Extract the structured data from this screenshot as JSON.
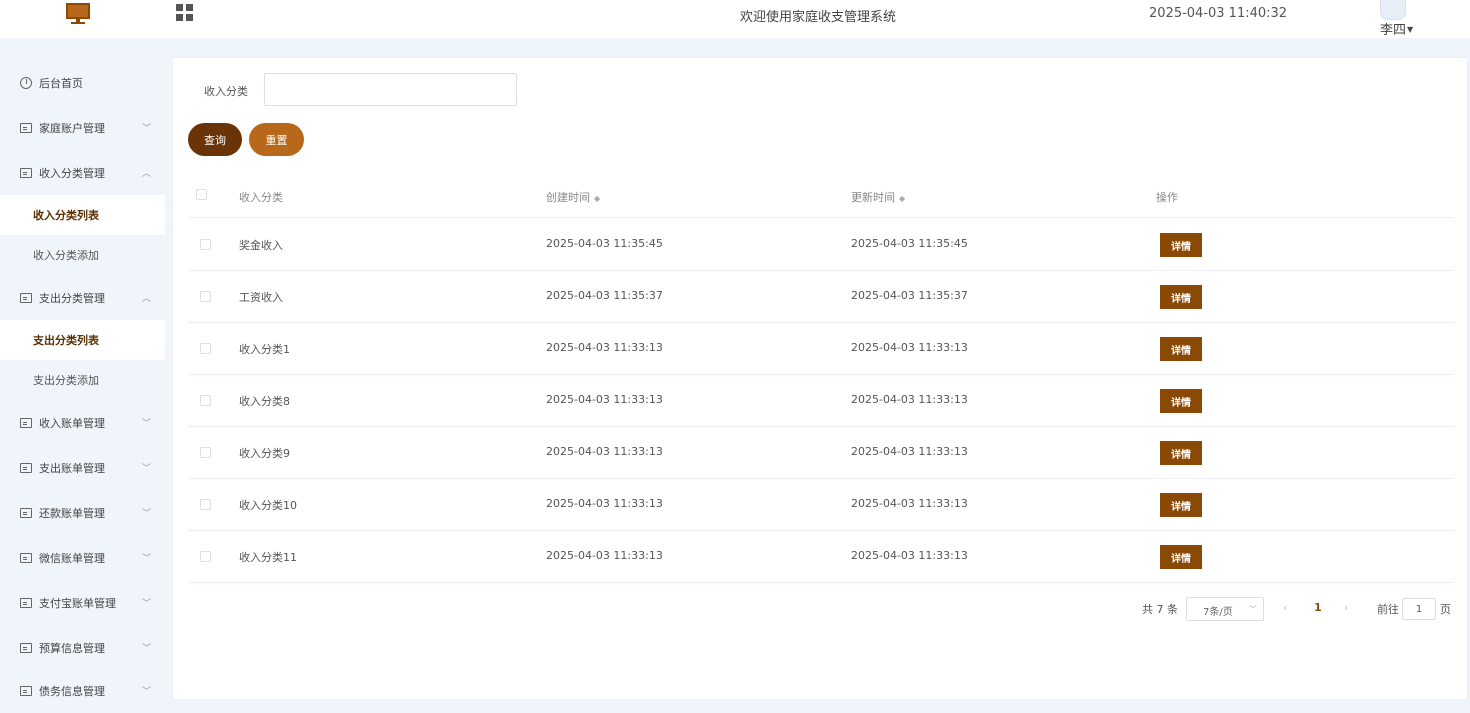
{
  "header": {
    "title": "欢迎使用家庭收支管理系统",
    "datetime": "2025-04-03 11:40:32",
    "user": "李四"
  },
  "sidebar": {
    "items": [
      {
        "label": "后台首页"
      },
      {
        "label": "家庭账户管理"
      },
      {
        "label": "收入分类管理"
      },
      {
        "label": "收入分类列表"
      },
      {
        "label": "收入分类添加"
      },
      {
        "label": "支出分类管理"
      },
      {
        "label": "支出分类列表"
      },
      {
        "label": "支出分类添加"
      },
      {
        "label": "收入账单管理"
      },
      {
        "label": "支出账单管理"
      },
      {
        "label": "还款账单管理"
      },
      {
        "label": "微信账单管理"
      },
      {
        "label": "支付宝账单管理"
      },
      {
        "label": "预算信息管理"
      },
      {
        "label": "债务信息管理"
      }
    ]
  },
  "search": {
    "label": "收入分类",
    "value": "",
    "query_label": "查询",
    "reset_label": "重置"
  },
  "table": {
    "columns": [
      "收入分类",
      "创建时间",
      "更新时间",
      "操作"
    ],
    "detail_label": "详情",
    "rows": [
      {
        "name": "奖金收入",
        "created": "2025-04-03 11:35:45",
        "updated": "2025-04-03 11:35:45"
      },
      {
        "name": "工资收入",
        "created": "2025-04-03 11:35:37",
        "updated": "2025-04-03 11:35:37"
      },
      {
        "name": "收入分类1",
        "created": "2025-04-03 11:33:13",
        "updated": "2025-04-03 11:33:13"
      },
      {
        "name": "收入分类8",
        "created": "2025-04-03 11:33:13",
        "updated": "2025-04-03 11:33:13"
      },
      {
        "name": "收入分类9",
        "created": "2025-04-03 11:33:13",
        "updated": "2025-04-03 11:33:13"
      },
      {
        "name": "收入分类10",
        "created": "2025-04-03 11:33:13",
        "updated": "2025-04-03 11:33:13"
      },
      {
        "name": "收入分类11",
        "created": "2025-04-03 11:33:13",
        "updated": "2025-04-03 11:33:13"
      }
    ]
  },
  "pagination": {
    "total": "共 7 条",
    "page_size": "7条/页",
    "current_page": "1",
    "goto_label": "前往",
    "goto_value": "1",
    "page_suffix": "页"
  },
  "colors": {
    "primary": "#6b3408",
    "secondary": "#b8681a",
    "detail": "#8a4a06"
  }
}
